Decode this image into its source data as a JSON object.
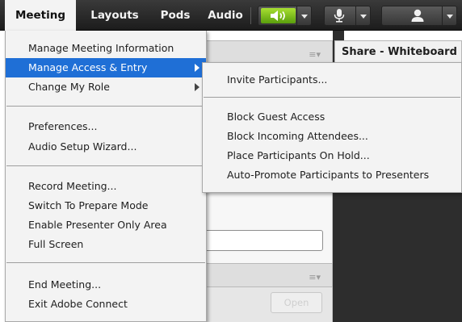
{
  "menubar": {
    "menus": [
      {
        "label": "Meeting",
        "active": true
      },
      {
        "label": "Layouts",
        "active": false
      },
      {
        "label": "Pods",
        "active": false
      },
      {
        "label": "Audio",
        "active": false
      }
    ],
    "icons": [
      "speaker-icon",
      "microphone-icon",
      "user-icon"
    ],
    "accent_color": "#7ac51f"
  },
  "meeting_menu": {
    "items": [
      {
        "label": "Manage Meeting Information"
      },
      {
        "label": "Manage Access & Entry",
        "highlighted": true,
        "has_submenu": true
      },
      {
        "label": "Change My Role",
        "has_submenu": true
      },
      {
        "label": "Preferences..."
      },
      {
        "label": "Audio Setup Wizard..."
      },
      {
        "label": "Record Meeting..."
      },
      {
        "label": "Switch To Prepare Mode"
      },
      {
        "label": "Enable Presenter Only Area"
      },
      {
        "label": "Full Screen"
      },
      {
        "label": "End Meeting..."
      },
      {
        "label": "Exit Adobe Connect"
      }
    ],
    "highlight_color": "#1f6fd6"
  },
  "access_submenu": {
    "items": [
      {
        "label": "Invite Participants..."
      },
      {
        "label": "Block Guest Access"
      },
      {
        "label": "Block Incoming Attendees..."
      },
      {
        "label": "Place Participants On Hold..."
      },
      {
        "label": "Auto-Promote Participants to Presenters"
      }
    ]
  },
  "share_pod": {
    "title": "Share - Whiteboard"
  },
  "files_pod": {
    "open_label": "Open"
  }
}
